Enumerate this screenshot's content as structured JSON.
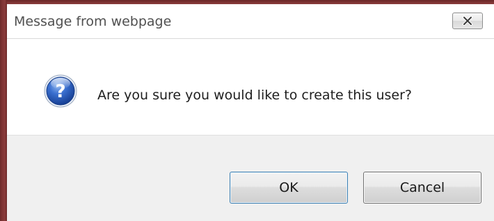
{
  "dialog": {
    "title": "Message from webpage",
    "message": "Are you sure you would like to create this user?",
    "icon": "question-icon"
  },
  "buttons": {
    "ok_label": "OK",
    "cancel_label": "Cancel"
  },
  "colors": {
    "frame": "#7e3434",
    "footer_bg": "#f0f0f0",
    "icon_blue": "#2a5db8"
  }
}
